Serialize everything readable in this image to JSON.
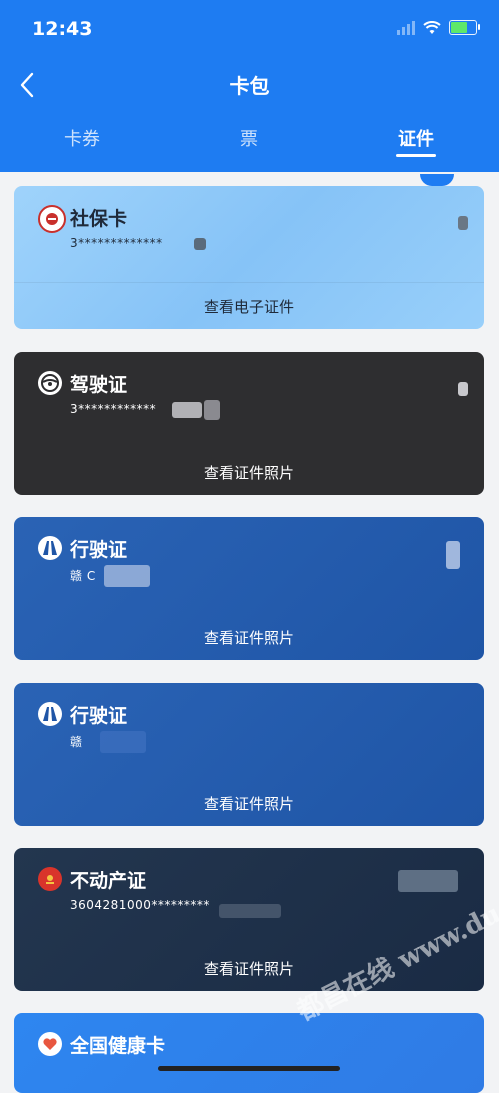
{
  "status": {
    "time": "12:43"
  },
  "header": {
    "title": "卡包"
  },
  "tabs": [
    {
      "label": "卡券"
    },
    {
      "label": "票"
    },
    {
      "label": "证件",
      "active": true
    }
  ],
  "cards": [
    {
      "name": "社保卡",
      "number": "3*************",
      "action": "查看电子证件",
      "icon": "social-security-icon"
    },
    {
      "name": "驾驶证",
      "number": "3************",
      "action": "查看证件照片",
      "icon": "steering-wheel-icon"
    },
    {
      "name": "行驶证",
      "number": "赣 C",
      "action": "查看证件照片",
      "icon": "road-icon"
    },
    {
      "name": "行驶证",
      "number": "赣",
      "action": "查看证件照片",
      "icon": "road-icon"
    },
    {
      "name": "不动产证",
      "number": "3604281000*********",
      "action": "查看证件照片",
      "icon": "national-emblem-icon"
    },
    {
      "name": "全国健康卡",
      "icon": "heart-icon"
    }
  ],
  "watermark": "都昌在线 www.duchang.org"
}
